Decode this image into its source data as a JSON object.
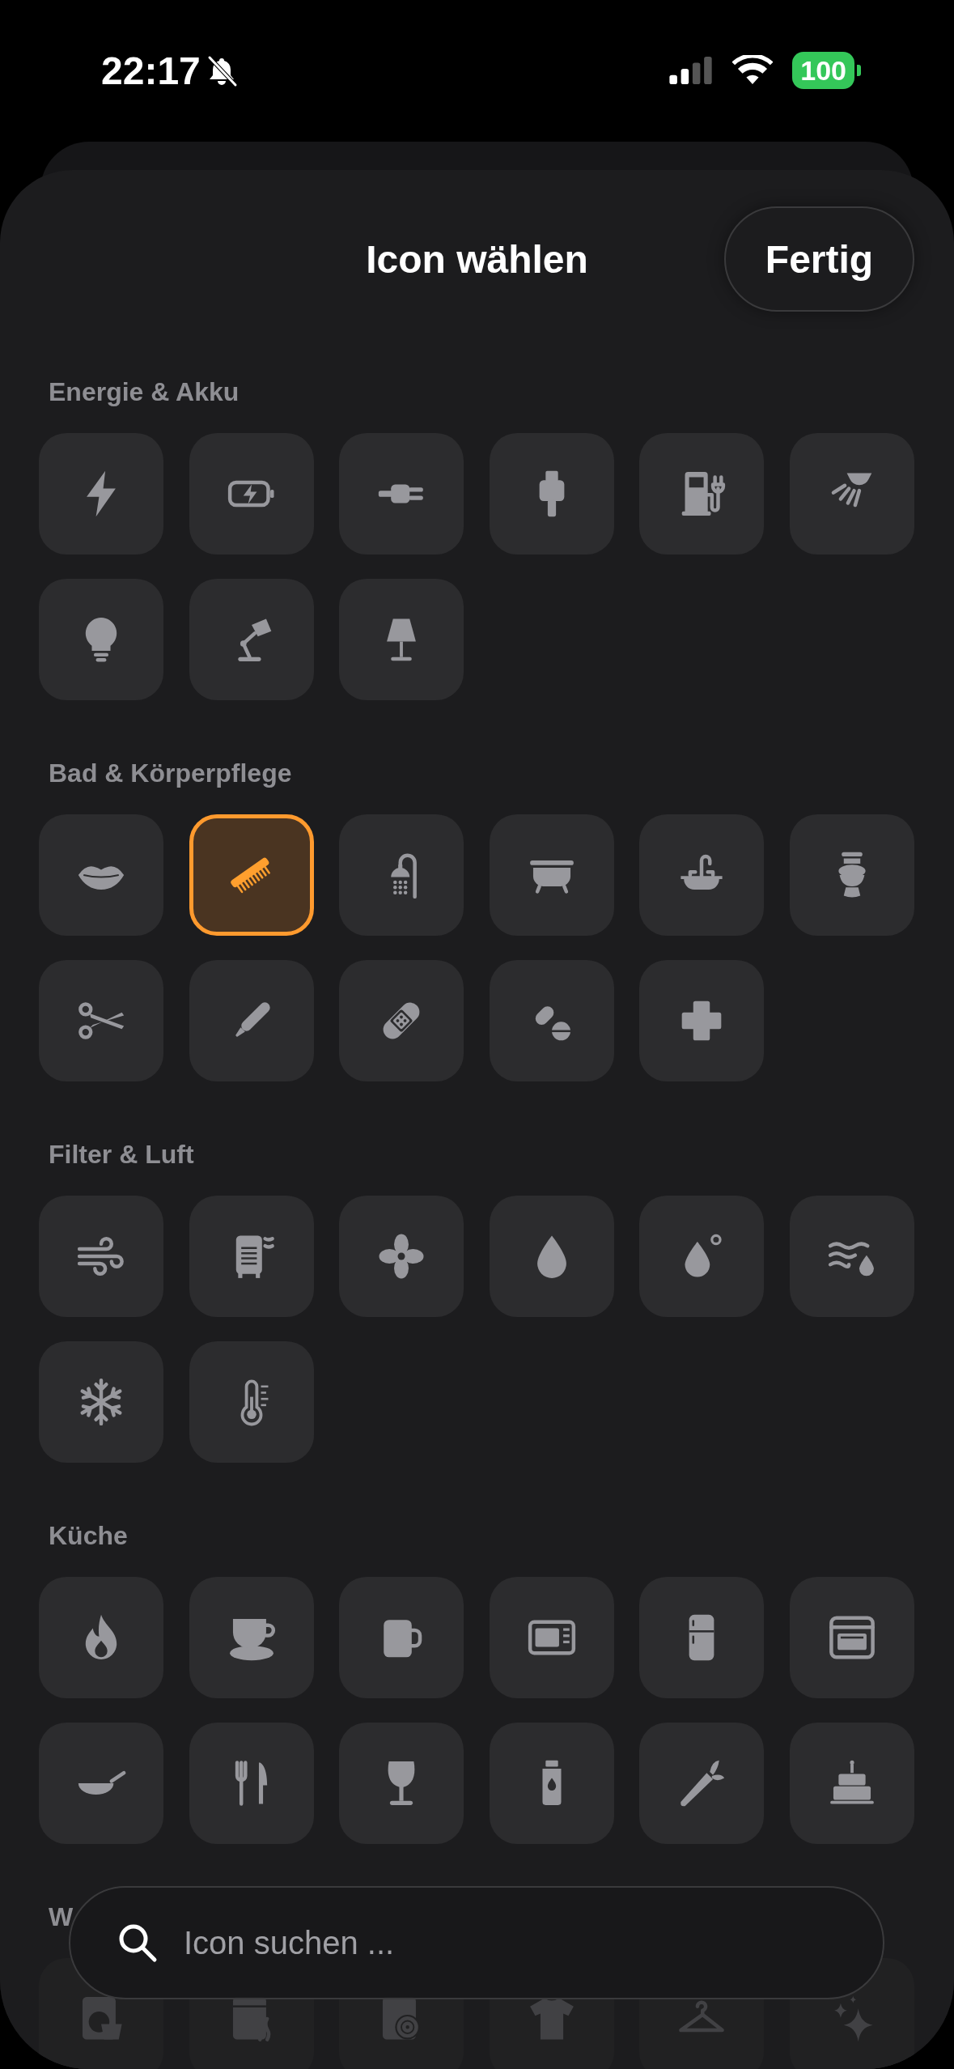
{
  "status_bar": {
    "time": "22:17",
    "silent": true,
    "battery": "100"
  },
  "header": {
    "title": "Icon wählen",
    "done_button": "Fertig"
  },
  "sections": [
    {
      "title": "Energie & Akku",
      "icons": [
        {
          "kind": "bolt",
          "selected": false
        },
        {
          "kind": "battery-charging",
          "selected": false
        },
        {
          "kind": "plug",
          "selected": false
        },
        {
          "kind": "cable",
          "selected": false
        },
        {
          "kind": "charging-station",
          "selected": false
        },
        {
          "kind": "spotlight",
          "selected": false
        },
        {
          "kind": "lightbulb",
          "selected": false
        },
        {
          "kind": "desk-lamp",
          "selected": false
        },
        {
          "kind": "table-lamp",
          "selected": false
        }
      ]
    },
    {
      "title": "Bad & Körperpflege",
      "icons": [
        {
          "kind": "lips",
          "selected": false
        },
        {
          "kind": "comb",
          "selected": true
        },
        {
          "kind": "shower",
          "selected": false
        },
        {
          "kind": "bathtub",
          "selected": false
        },
        {
          "kind": "sink",
          "selected": false
        },
        {
          "kind": "toilet",
          "selected": false
        },
        {
          "kind": "scissors",
          "selected": false
        },
        {
          "kind": "thermometer",
          "selected": false
        },
        {
          "kind": "bandage",
          "selected": false
        },
        {
          "kind": "pills",
          "selected": false
        },
        {
          "kind": "cross",
          "selected": false
        }
      ]
    },
    {
      "title": "Filter & Luft",
      "icons": [
        {
          "kind": "wind",
          "selected": false
        },
        {
          "kind": "air-purifier",
          "selected": false
        },
        {
          "kind": "fan",
          "selected": false
        },
        {
          "kind": "drop",
          "selected": false
        },
        {
          "kind": "humidity",
          "selected": false
        },
        {
          "kind": "water-waves",
          "selected": false
        },
        {
          "kind": "snowflake",
          "selected": false
        },
        {
          "kind": "thermometer-scale",
          "selected": false
        }
      ]
    },
    {
      "title": "Küche",
      "icons": [
        {
          "kind": "flame",
          "selected": false
        },
        {
          "kind": "cup-saucer",
          "selected": false
        },
        {
          "kind": "mug",
          "selected": false
        },
        {
          "kind": "microwave",
          "selected": false
        },
        {
          "kind": "fridge",
          "selected": false
        },
        {
          "kind": "oven",
          "selected": false
        },
        {
          "kind": "frying-pan",
          "selected": false
        },
        {
          "kind": "fork-knife",
          "selected": false
        },
        {
          "kind": "wine-glass",
          "selected": false
        },
        {
          "kind": "bottle",
          "selected": false
        },
        {
          "kind": "carrot",
          "selected": false
        },
        {
          "kind": "cake",
          "selected": false
        }
      ]
    },
    {
      "title": "W",
      "icons": [
        {
          "kind": "washer-basin",
          "selected": false
        },
        {
          "kind": "dishwasher",
          "selected": false
        },
        {
          "kind": "washer",
          "selected": false
        },
        {
          "kind": "tshirt",
          "selected": false
        },
        {
          "kind": "hanger",
          "selected": false
        },
        {
          "kind": "sparkles",
          "selected": false
        }
      ]
    }
  ],
  "search": {
    "placeholder": "Icon suchen ..."
  }
}
